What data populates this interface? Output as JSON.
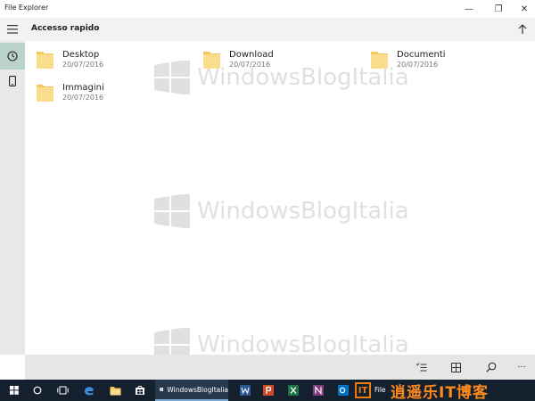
{
  "window": {
    "title": "File Explorer",
    "controls": {
      "minimize": "—",
      "maximize": "❐",
      "close": "✕"
    }
  },
  "header": {
    "title": "Accesso rapido",
    "up_icon": "arrow-up-icon",
    "menu_icon": "hamburger-icon"
  },
  "rail": {
    "items": [
      {
        "icon": "clock-icon",
        "active": true
      },
      {
        "icon": "phone-icon",
        "active": false
      }
    ]
  },
  "folders": [
    {
      "name": "Desktop",
      "date": "20/07/2016"
    },
    {
      "name": "Download",
      "date": "20/07/2016"
    },
    {
      "name": "Documenti",
      "date": "20/07/2016"
    },
    {
      "name": "Immagini",
      "date": "20/07/2016"
    }
  ],
  "watermark": {
    "text": "WindowsBlogItalia"
  },
  "commandbar": {
    "items": [
      "select-icon",
      "grid-view-icon",
      "search-icon",
      "more-icon"
    ],
    "more_label": "···"
  },
  "taskbar": {
    "active_app_label": "WindowsBlogItalia",
    "file_label": "File",
    "brand_it": "IT",
    "brand_text": "逍遥乐IT博客"
  },
  "colors": {
    "folder": "#f7d77b",
    "rail_active": "#bad3cc",
    "taskbar": "#14202e",
    "brand": "#ff8a1c"
  }
}
